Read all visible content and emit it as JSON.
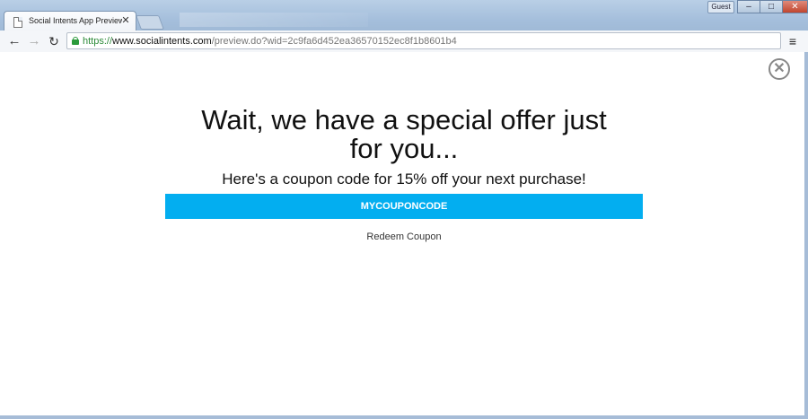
{
  "browser": {
    "tab_title": "Social Intents App Preview",
    "tab_close": "✕",
    "guest_label": "Guest",
    "window_buttons": {
      "minimize": "‒",
      "maximize": "□",
      "close": "✕"
    },
    "nav": {
      "back": "←",
      "forward": "→",
      "reload": "↻",
      "menu": "≡"
    },
    "url": {
      "scheme": "https://",
      "host": "www.socialintents.com",
      "path": "/preview.do?wid=2c9fa6d452ea36570152ec8f1b8601b4"
    }
  },
  "popup": {
    "close_icon": "✕",
    "title": "Wait, we have a special offer just for you...",
    "subtitle": "Here's a coupon code for 15% off your next purchase!",
    "coupon_code": "MYCOUPONCODE",
    "redeem_label": "Redeem Coupon"
  },
  "colors": {
    "coupon_bar": "#03aef0",
    "url_scheme": "#2e8b3a"
  }
}
